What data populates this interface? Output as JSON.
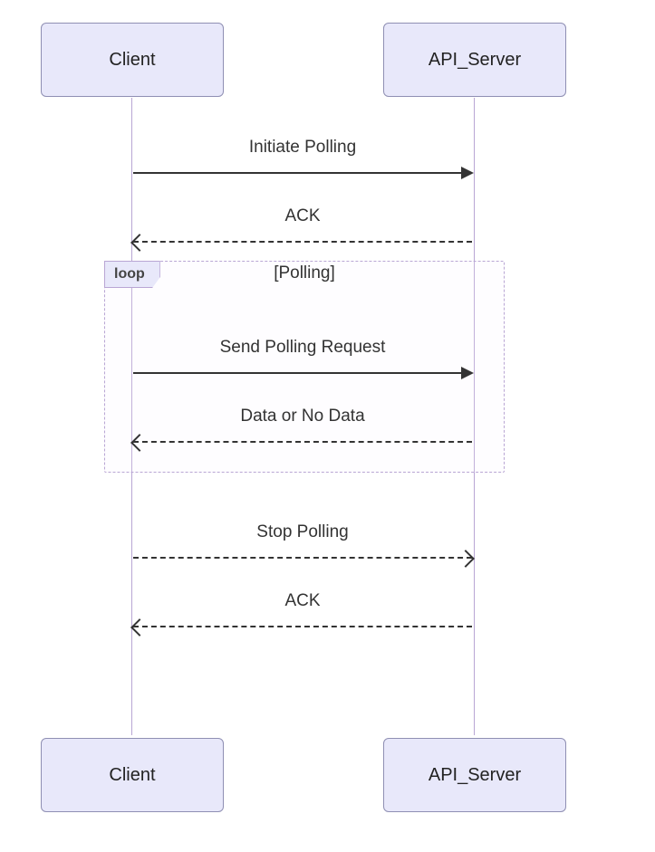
{
  "participants": {
    "client": "Client",
    "server": "API_Server"
  },
  "messages": {
    "m1": "Initiate Polling",
    "m2": "ACK",
    "m3": "Send Polling Request",
    "m4": "Data or No Data",
    "m5": "Stop Polling",
    "m6": "ACK"
  },
  "loop": {
    "tag": "loop",
    "title": "[Polling]"
  }
}
